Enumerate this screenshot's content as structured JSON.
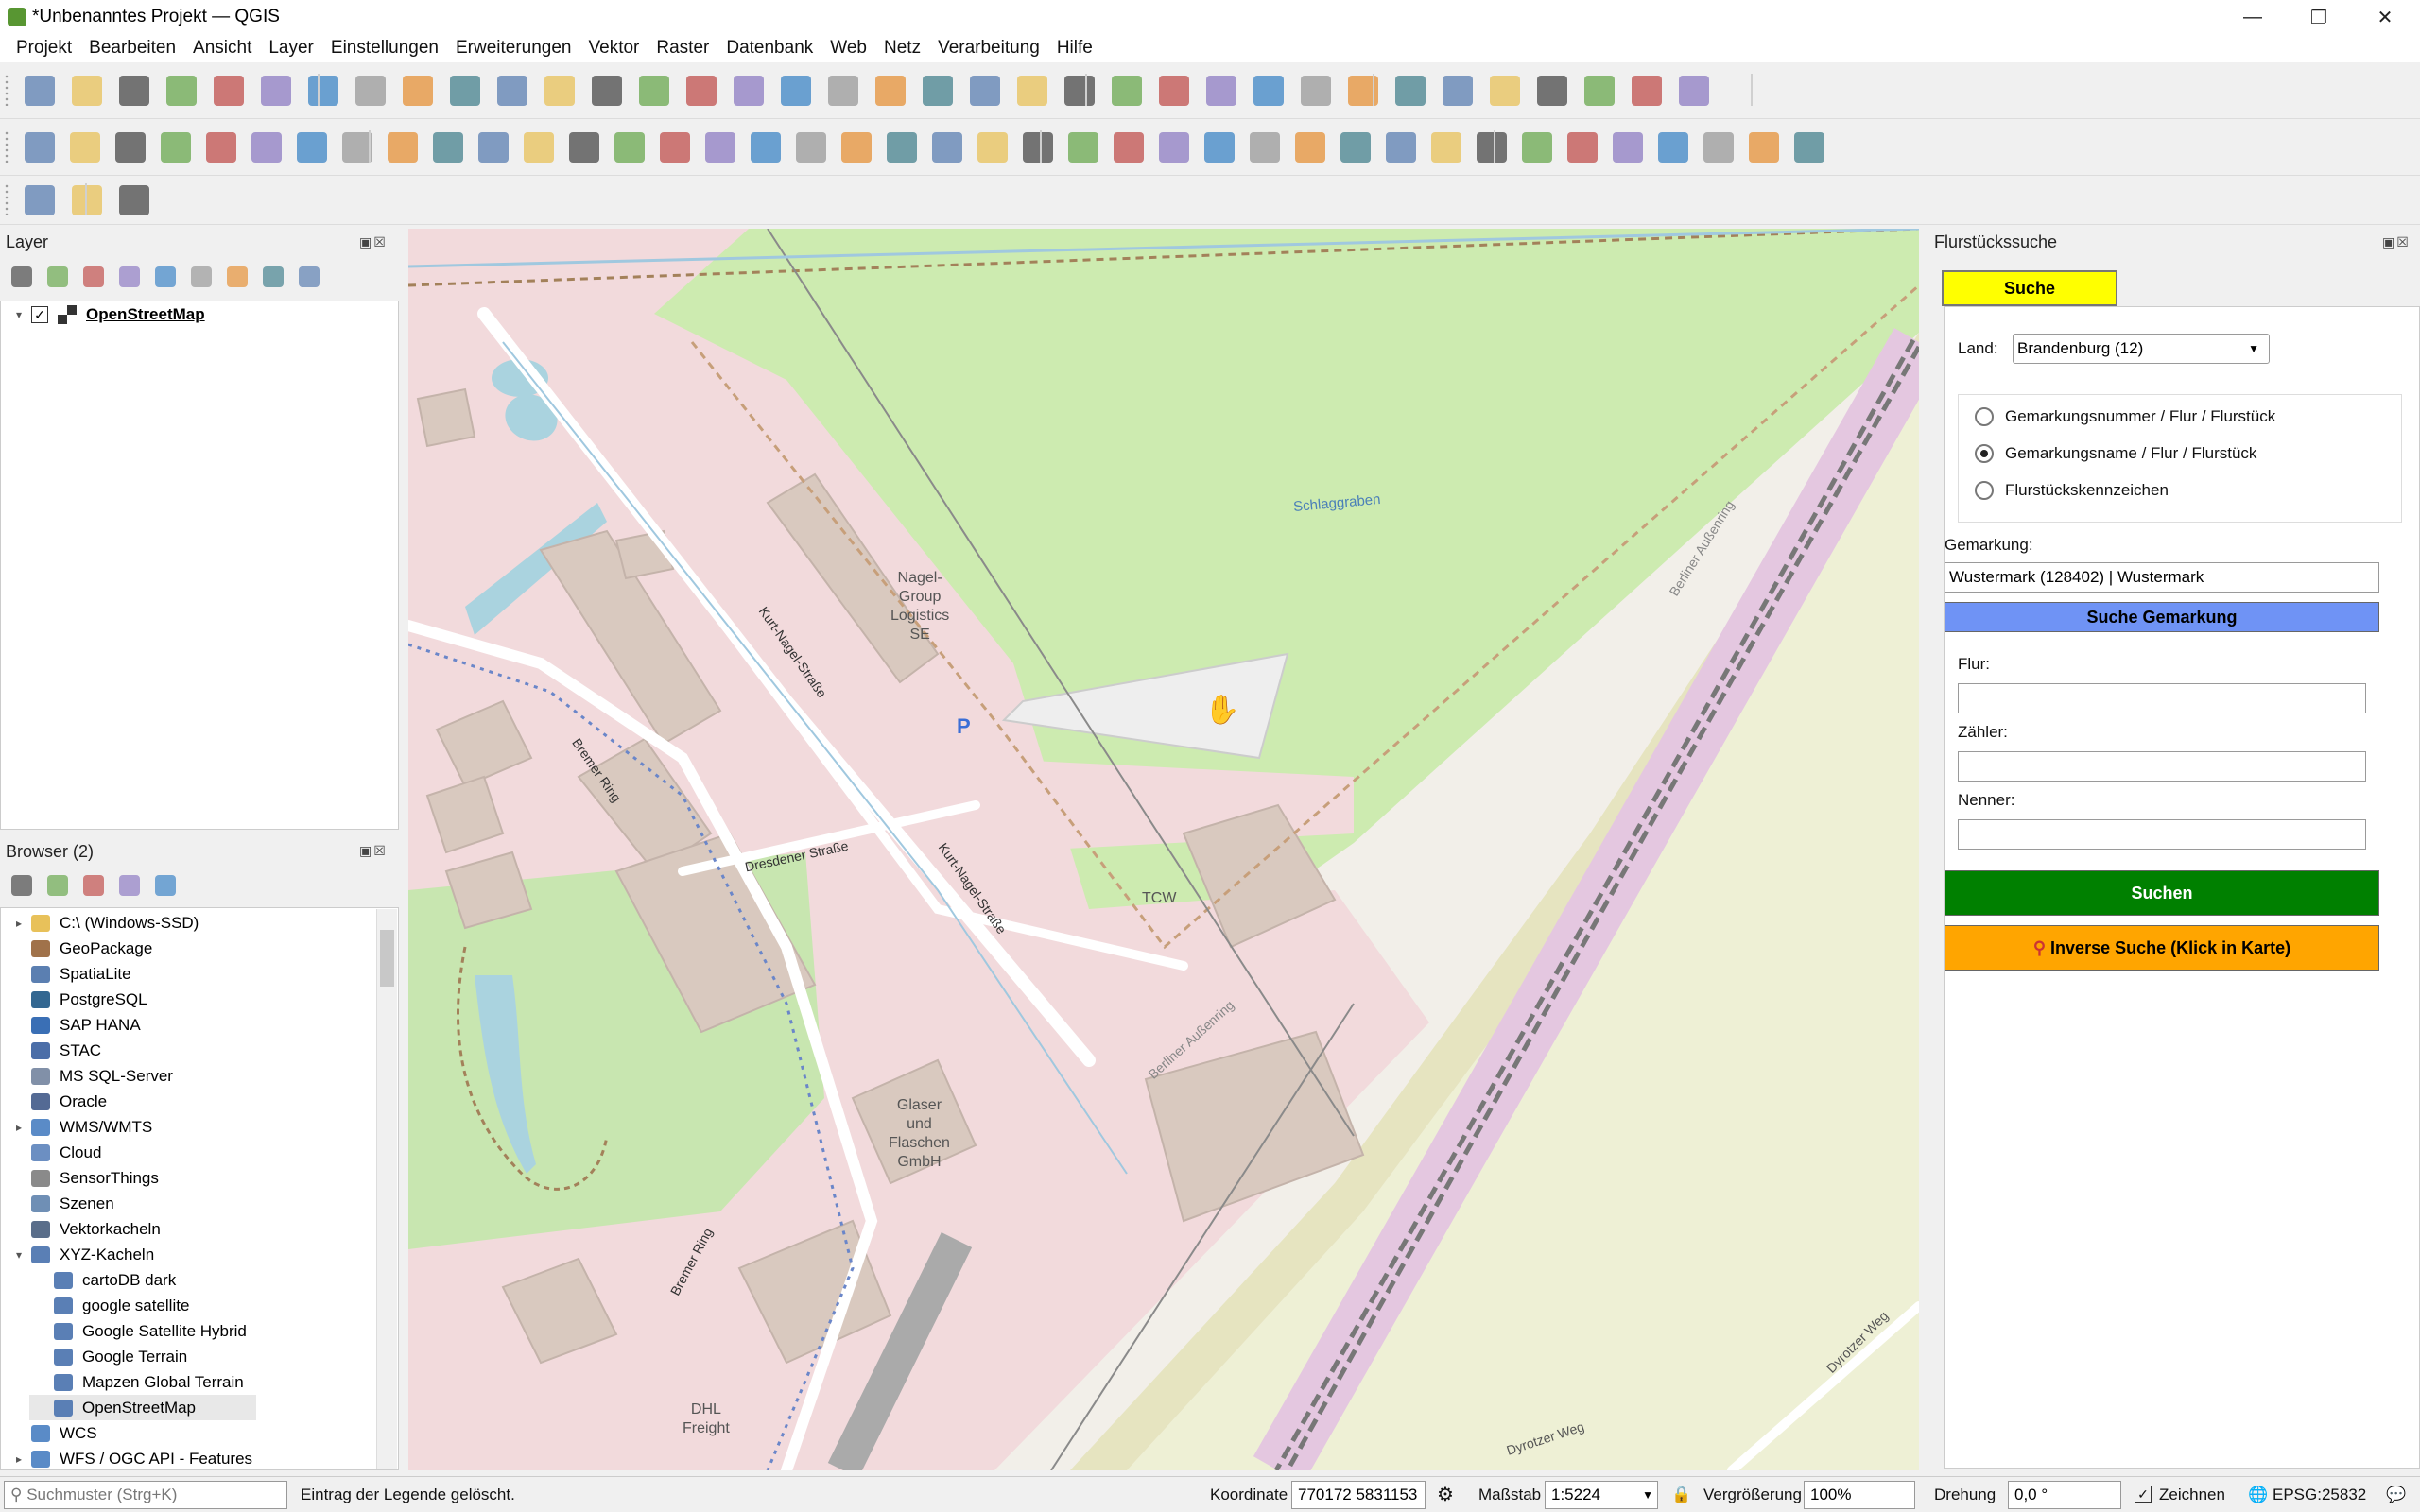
{
  "window": {
    "title": "*Unbenanntes Projekt — QGIS"
  },
  "menu": [
    "Projekt",
    "Bearbeiten",
    "Ansicht",
    "Layer",
    "Einstellungen",
    "Erweiterungen",
    "Vektor",
    "Raster",
    "Datenbank",
    "Web",
    "Netz",
    "Verarbeitung",
    "Hilfe"
  ],
  "layers_panel": {
    "title": "Layer",
    "layers": [
      {
        "name": "OpenStreetMap",
        "checked": true
      }
    ]
  },
  "browser_panel": {
    "title": "Browser (2)",
    "items": [
      {
        "label": "C:\\ (Windows-SSD)",
        "expander": "▸",
        "indent": 0,
        "icon": "folder-icon",
        "color": "#e8c15a"
      },
      {
        "label": "GeoPackage",
        "expander": "",
        "indent": 0,
        "icon": "geopackage-icon",
        "color": "#a0724a"
      },
      {
        "label": "SpatiaLite",
        "expander": "",
        "indent": 0,
        "icon": "spatialite-icon",
        "color": "#5b7fb1"
      },
      {
        "label": "PostgreSQL",
        "expander": "",
        "indent": 0,
        "icon": "postgresql-icon",
        "color": "#336791"
      },
      {
        "label": "SAP HANA",
        "expander": "",
        "indent": 0,
        "icon": "saphana-icon",
        "color": "#3a6fb5"
      },
      {
        "label": "STAC",
        "expander": "",
        "indent": 0,
        "icon": "stac-icon",
        "color": "#4b6ea8"
      },
      {
        "label": "MS SQL-Server",
        "expander": "",
        "indent": 0,
        "icon": "mssql-icon",
        "color": "#8190a8"
      },
      {
        "label": "Oracle",
        "expander": "",
        "indent": 0,
        "icon": "oracle-icon",
        "color": "#546a94"
      },
      {
        "label": "WMS/WMTS",
        "expander": "▸",
        "indent": 0,
        "icon": "wms-icon",
        "color": "#5a8bc7"
      },
      {
        "label": "Cloud",
        "expander": "",
        "indent": 0,
        "icon": "cloud-icon",
        "color": "#6c8fc2"
      },
      {
        "label": "SensorThings",
        "expander": "",
        "indent": 0,
        "icon": "sensorthings-icon",
        "color": "#8a8a8a"
      },
      {
        "label": "Szenen",
        "expander": "",
        "indent": 0,
        "icon": "scenes-icon",
        "color": "#6f8fb5"
      },
      {
        "label": "Vektorkacheln",
        "expander": "",
        "indent": 0,
        "icon": "vectortiles-icon",
        "color": "#5a6e8a"
      },
      {
        "label": "XYZ-Kacheln",
        "expander": "▾",
        "indent": 0,
        "icon": "xyz-icon",
        "color": "#5a7fb5"
      },
      {
        "label": "cartoDB dark",
        "expander": "",
        "indent": 1,
        "icon": "tile-icon",
        "color": "#5a7fb5"
      },
      {
        "label": "google satellite",
        "expander": "",
        "indent": 1,
        "icon": "tile-icon",
        "color": "#5a7fb5"
      },
      {
        "label": "Google Satellite Hybrid",
        "expander": "",
        "indent": 1,
        "icon": "tile-icon",
        "color": "#5a7fb5"
      },
      {
        "label": "Google Terrain",
        "expander": "",
        "indent": 1,
        "icon": "tile-icon",
        "color": "#5a7fb5"
      },
      {
        "label": "Mapzen Global Terrain",
        "expander": "",
        "indent": 1,
        "icon": "tile-icon",
        "color": "#5a7fb5"
      },
      {
        "label": "OpenStreetMap",
        "expander": "",
        "indent": 1,
        "icon": "tile-icon",
        "color": "#5a7fb5"
      },
      {
        "label": "WCS",
        "expander": "",
        "indent": 0,
        "icon": "wcs-icon",
        "color": "#5a8bc7"
      },
      {
        "label": "WFS / OGC API - Features",
        "expander": "▸",
        "indent": 0,
        "icon": "wfs-icon",
        "color": "#5a8bc7"
      }
    ]
  },
  "map_labels": {
    "schlaggraben": "Schlaggraben",
    "nagel": "Nagel-\nGroup\nLogistics\nSE",
    "kurt1": "Kurt-Nagel-Straße",
    "kurt2": "Kurt-Nagel-Straße",
    "dresdener": "Dresdener Straße",
    "bremer1": "Bremer Ring",
    "bremer2": "Bremer Ring",
    "tcw": "TCW",
    "glaser": "Glaser\nund\nFlaschen\nGmbH",
    "berliner1": "Berliner Außenring",
    "berliner2": "Berliner Außenring",
    "dyrotzer1": "Dyrotzer Weg",
    "dyrotzer2": "Dyrotzer Weg",
    "dhl": "DHL\nFreight",
    "parking": "P"
  },
  "plugin": {
    "title": "Flurstückssuche",
    "tab": "Suche",
    "land_label": "Land:",
    "land_value": "Brandenburg (12)",
    "radio": [
      {
        "label": "Gemarkungsnummer / Flur / Flurstück",
        "checked": false
      },
      {
        "label": "Gemarkungsname / Flur / Flurstück",
        "checked": true
      },
      {
        "label": "Flurstückskennzeichen",
        "checked": false
      }
    ],
    "gemarkung_label": "Gemarkung:",
    "gemarkung_value": "Wustermark (128402) | Wustermark",
    "btn_gemarkung": "Suche Gemarkung",
    "flur_label": "Flur:",
    "zaehler_label": "Zähler:",
    "nenner_label": "Nenner:",
    "btn_suchen": "Suchen",
    "btn_inverse": "Inverse Suche (Klick in Karte)",
    "colors": {
      "tab": "#ffff00",
      "gemarkung": "#6f93f5",
      "suchen": "#008000",
      "inverse": "#ffa500"
    }
  },
  "status": {
    "search_placeholder": "Suchmuster (Strg+K)",
    "message": "Eintrag der Legende gelöscht.",
    "coord_label": "Koordinate",
    "coord_value": "770172  5831153",
    "scale_label": "Maßstab",
    "scale_value": "1:5224",
    "zoom_label": "Vergrößerung",
    "zoom_value": "100%",
    "rotation_label": "Drehung",
    "rotation_value": "0,0 °",
    "render_label": "Zeichnen",
    "crs": "EPSG:25832"
  }
}
